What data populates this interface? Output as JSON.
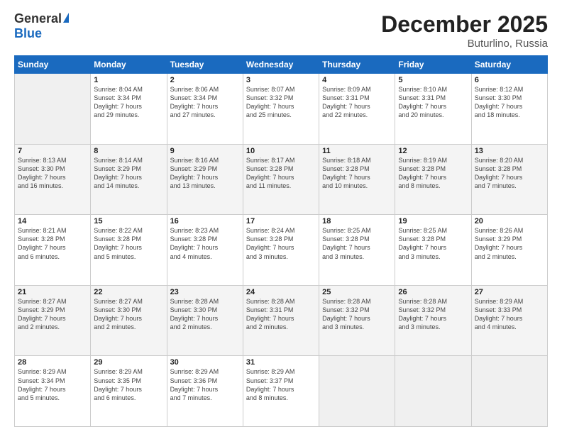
{
  "logo": {
    "general": "General",
    "blue": "Blue"
  },
  "title": "December 2025",
  "subtitle": "Buturlino, Russia",
  "days_header": [
    "Sunday",
    "Monday",
    "Tuesday",
    "Wednesday",
    "Thursday",
    "Friday",
    "Saturday"
  ],
  "weeks": [
    [
      {
        "num": "",
        "info": ""
      },
      {
        "num": "1",
        "info": "Sunrise: 8:04 AM\nSunset: 3:34 PM\nDaylight: 7 hours\nand 29 minutes."
      },
      {
        "num": "2",
        "info": "Sunrise: 8:06 AM\nSunset: 3:34 PM\nDaylight: 7 hours\nand 27 minutes."
      },
      {
        "num": "3",
        "info": "Sunrise: 8:07 AM\nSunset: 3:32 PM\nDaylight: 7 hours\nand 25 minutes."
      },
      {
        "num": "4",
        "info": "Sunrise: 8:09 AM\nSunset: 3:31 PM\nDaylight: 7 hours\nand 22 minutes."
      },
      {
        "num": "5",
        "info": "Sunrise: 8:10 AM\nSunset: 3:31 PM\nDaylight: 7 hours\nand 20 minutes."
      },
      {
        "num": "6",
        "info": "Sunrise: 8:12 AM\nSunset: 3:30 PM\nDaylight: 7 hours\nand 18 minutes."
      }
    ],
    [
      {
        "num": "7",
        "info": "Sunrise: 8:13 AM\nSunset: 3:30 PM\nDaylight: 7 hours\nand 16 minutes."
      },
      {
        "num": "8",
        "info": "Sunrise: 8:14 AM\nSunset: 3:29 PM\nDaylight: 7 hours\nand 14 minutes."
      },
      {
        "num": "9",
        "info": "Sunrise: 8:16 AM\nSunset: 3:29 PM\nDaylight: 7 hours\nand 13 minutes."
      },
      {
        "num": "10",
        "info": "Sunrise: 8:17 AM\nSunset: 3:28 PM\nDaylight: 7 hours\nand 11 minutes."
      },
      {
        "num": "11",
        "info": "Sunrise: 8:18 AM\nSunset: 3:28 PM\nDaylight: 7 hours\nand 10 minutes."
      },
      {
        "num": "12",
        "info": "Sunrise: 8:19 AM\nSunset: 3:28 PM\nDaylight: 7 hours\nand 8 minutes."
      },
      {
        "num": "13",
        "info": "Sunrise: 8:20 AM\nSunset: 3:28 PM\nDaylight: 7 hours\nand 7 minutes."
      }
    ],
    [
      {
        "num": "14",
        "info": "Sunrise: 8:21 AM\nSunset: 3:28 PM\nDaylight: 7 hours\nand 6 minutes."
      },
      {
        "num": "15",
        "info": "Sunrise: 8:22 AM\nSunset: 3:28 PM\nDaylight: 7 hours\nand 5 minutes."
      },
      {
        "num": "16",
        "info": "Sunrise: 8:23 AM\nSunset: 3:28 PM\nDaylight: 7 hours\nand 4 minutes."
      },
      {
        "num": "17",
        "info": "Sunrise: 8:24 AM\nSunset: 3:28 PM\nDaylight: 7 hours\nand 3 minutes."
      },
      {
        "num": "18",
        "info": "Sunrise: 8:25 AM\nSunset: 3:28 PM\nDaylight: 7 hours\nand 3 minutes."
      },
      {
        "num": "19",
        "info": "Sunrise: 8:25 AM\nSunset: 3:28 PM\nDaylight: 7 hours\nand 3 minutes."
      },
      {
        "num": "20",
        "info": "Sunrise: 8:26 AM\nSunset: 3:29 PM\nDaylight: 7 hours\nand 2 minutes."
      }
    ],
    [
      {
        "num": "21",
        "info": "Sunrise: 8:27 AM\nSunset: 3:29 PM\nDaylight: 7 hours\nand 2 minutes."
      },
      {
        "num": "22",
        "info": "Sunrise: 8:27 AM\nSunset: 3:30 PM\nDaylight: 7 hours\nand 2 minutes."
      },
      {
        "num": "23",
        "info": "Sunrise: 8:28 AM\nSunset: 3:30 PM\nDaylight: 7 hours\nand 2 minutes."
      },
      {
        "num": "24",
        "info": "Sunrise: 8:28 AM\nSunset: 3:31 PM\nDaylight: 7 hours\nand 2 minutes."
      },
      {
        "num": "25",
        "info": "Sunrise: 8:28 AM\nSunset: 3:32 PM\nDaylight: 7 hours\nand 3 minutes."
      },
      {
        "num": "26",
        "info": "Sunrise: 8:28 AM\nSunset: 3:32 PM\nDaylight: 7 hours\nand 3 minutes."
      },
      {
        "num": "27",
        "info": "Sunrise: 8:29 AM\nSunset: 3:33 PM\nDaylight: 7 hours\nand 4 minutes."
      }
    ],
    [
      {
        "num": "28",
        "info": "Sunrise: 8:29 AM\nSunset: 3:34 PM\nDaylight: 7 hours\nand 5 minutes."
      },
      {
        "num": "29",
        "info": "Sunrise: 8:29 AM\nSunset: 3:35 PM\nDaylight: 7 hours\nand 6 minutes."
      },
      {
        "num": "30",
        "info": "Sunrise: 8:29 AM\nSunset: 3:36 PM\nDaylight: 7 hours\nand 7 minutes."
      },
      {
        "num": "31",
        "info": "Sunrise: 8:29 AM\nSunset: 3:37 PM\nDaylight: 7 hours\nand 8 minutes."
      },
      {
        "num": "",
        "info": ""
      },
      {
        "num": "",
        "info": ""
      },
      {
        "num": "",
        "info": ""
      }
    ]
  ]
}
